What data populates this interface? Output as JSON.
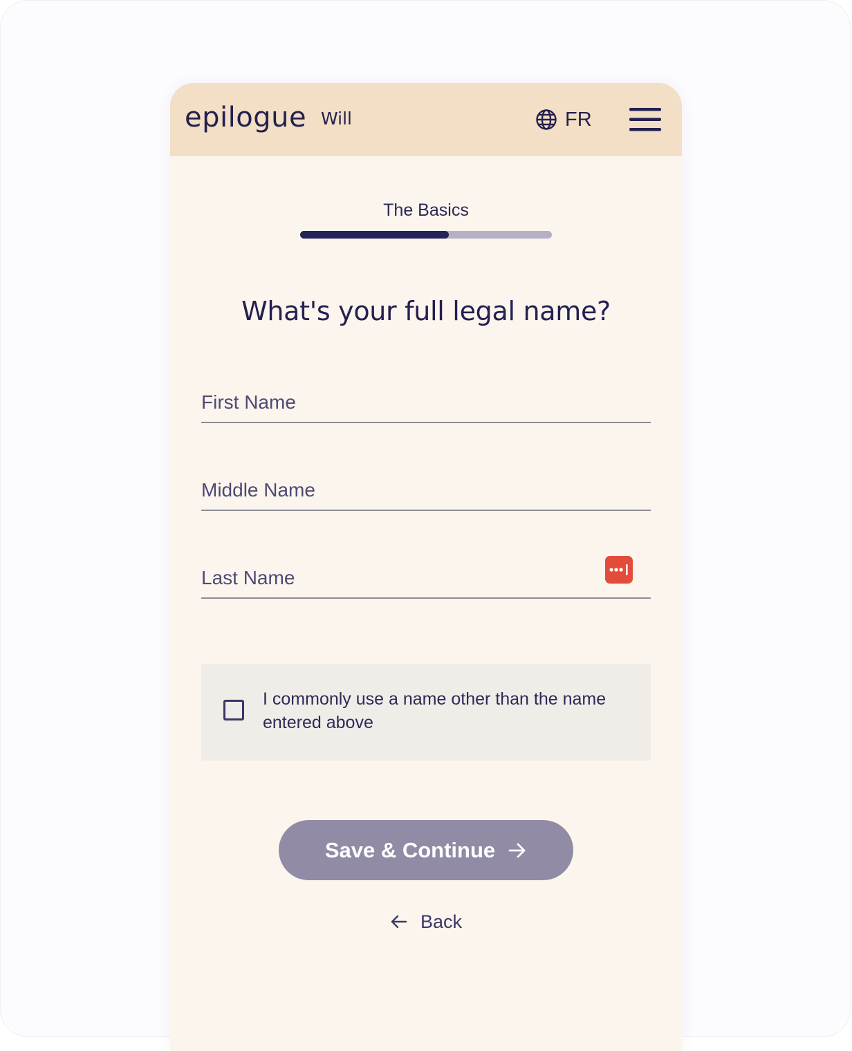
{
  "header": {
    "logo": "epilogue",
    "product": "Will",
    "language_label": "FR"
  },
  "progress": {
    "label": "The Basics",
    "percent": 59
  },
  "question": "What's your full legal name?",
  "fields": {
    "first_name_placeholder": "First Name",
    "middle_name_placeholder": "Middle Name",
    "last_name_placeholder": "Last Name"
  },
  "checkbox": {
    "label": "I commonly use a name other than the name entered above",
    "checked": false
  },
  "actions": {
    "save_label": "Save & Continue",
    "back_label": "Back"
  },
  "colors": {
    "header_bg": "#f3dfc5",
    "page_bg": "#fcf5ee",
    "brand_navy": "#24204f",
    "button_disabled": "#918ba6",
    "password_manager_red": "#e34c3b"
  },
  "icons": {
    "language": "globe-icon",
    "menu": "hamburger-menu-icon",
    "password_manager": "password-manager-icon",
    "save_arrow": "arrow-right-icon",
    "back_arrow": "arrow-left-icon"
  }
}
